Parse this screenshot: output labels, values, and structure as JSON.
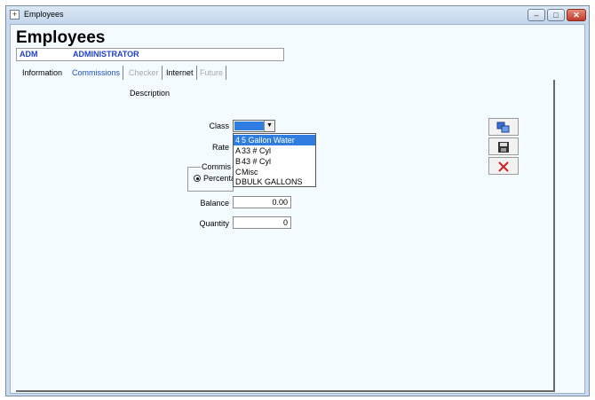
{
  "window": {
    "title": "Employees",
    "min": "–",
    "max": "□",
    "close": "✕"
  },
  "header": {
    "title": "Employees",
    "code": "ADM",
    "name": "ADMINISTRATOR"
  },
  "tabs": [
    {
      "label": "Information",
      "state": "normal"
    },
    {
      "label": "Commissions",
      "state": "active"
    },
    {
      "label": "Checker",
      "state": "disabled"
    },
    {
      "label": "Internet",
      "state": "normal"
    },
    {
      "label": "Future",
      "state": "disabled"
    }
  ],
  "form": {
    "description_label": "Description",
    "class_label": "Class",
    "rate_label": "Rate",
    "commission_group_label": "Commis",
    "percentage_label": "Percenta",
    "balance_label": "Balance",
    "balance_value": "0.00",
    "quantity_label": "Quantity",
    "quantity_value": "0"
  },
  "dropdown": {
    "items": [
      {
        "code": "4",
        "name": "5 Gallon Water",
        "selected": true
      },
      {
        "code": "A",
        "name": "33 # Cyl"
      },
      {
        "code": "B",
        "name": "43 # Cyl"
      },
      {
        "code": "C",
        "name": "Misc"
      },
      {
        "code": "D",
        "name": "BULK GALLONS"
      }
    ]
  },
  "toolbar": {
    "icons": [
      "copy-icon",
      "save-icon",
      "close-icon"
    ]
  },
  "colors": {
    "accent": "#2f7de1",
    "header_text": "#1f3fc8",
    "active_tab": "#2050c0",
    "delete": "#d42020"
  }
}
